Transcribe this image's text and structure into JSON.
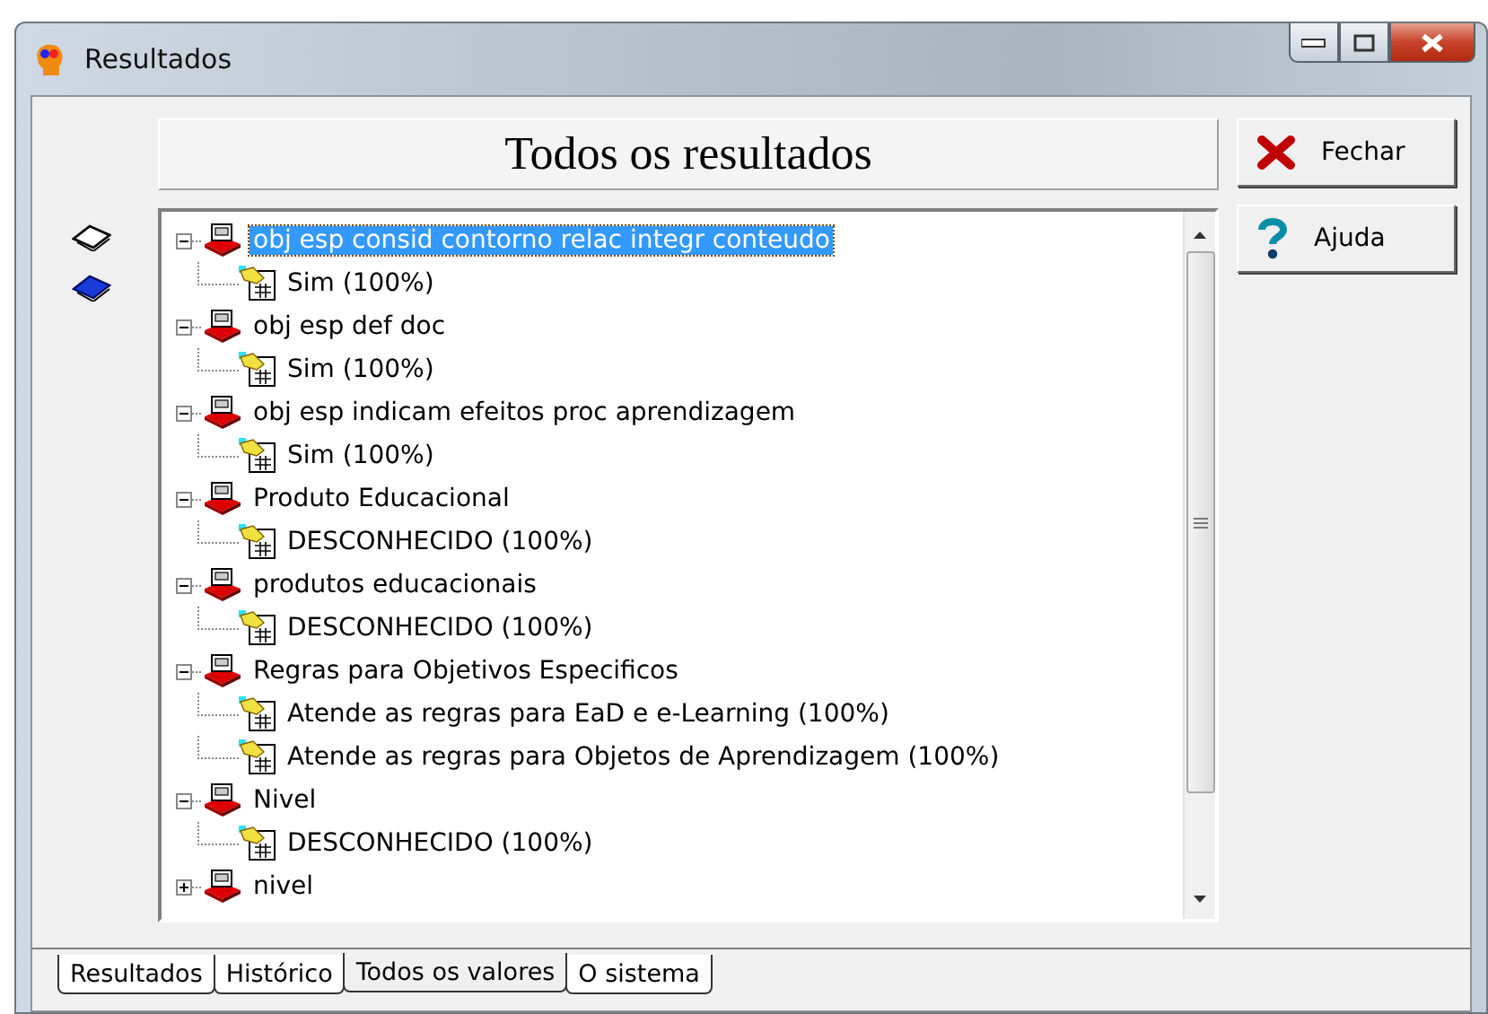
{
  "window": {
    "title": "Resultados"
  },
  "header": "Todos os resultados",
  "buttons": [
    {
      "kind": "close",
      "label": "Fechar"
    },
    {
      "kind": "help",
      "label": "Ajuda"
    }
  ],
  "tree": {
    "items": [
      {
        "label": "obj esp consid contorno relac integr conteudo",
        "expanded": true,
        "selected": true,
        "children": [
          {
            "label": "Sim (100%)",
            "selected": false
          }
        ]
      },
      {
        "label": "obj esp def doc",
        "expanded": true,
        "selected": false,
        "children": [
          {
            "label": "Sim (100%)",
            "selected": false
          }
        ]
      },
      {
        "label": "obj esp indicam efeitos proc aprendizagem",
        "expanded": true,
        "selected": false,
        "children": [
          {
            "label": "Sim (100%)",
            "selected": false
          }
        ]
      },
      {
        "label": "Produto Educacional",
        "expanded": true,
        "selected": false,
        "children": [
          {
            "label": "DESCONHECIDO (100%)",
            "selected": false
          }
        ]
      },
      {
        "label": "produtos educacionais",
        "expanded": true,
        "selected": false,
        "children": [
          {
            "label": "DESCONHECIDO (100%)",
            "selected": false
          }
        ]
      },
      {
        "label": "Regras para Objetivos Especificos",
        "expanded": true,
        "selected": false,
        "children": [
          {
            "label": "Atende as regras para EaD e e-Learning (100%)",
            "selected": false
          },
          {
            "label": "Atende as regras para Objetos de Aprendizagem (100%)",
            "selected": false
          }
        ]
      },
      {
        "label": "Nivel",
        "expanded": true,
        "selected": false,
        "children": [
          {
            "label": "DESCONHECIDO (100%)",
            "selected": false
          }
        ]
      },
      {
        "label": "nivel",
        "expanded": false,
        "selected": false
      }
    ]
  },
  "tabs": [
    {
      "label": "Resultados",
      "selected": false
    },
    {
      "label": "Histórico",
      "selected": false
    },
    {
      "label": "Todos os valores",
      "selected": true
    },
    {
      "label": "O sistema",
      "selected": false
    }
  ]
}
